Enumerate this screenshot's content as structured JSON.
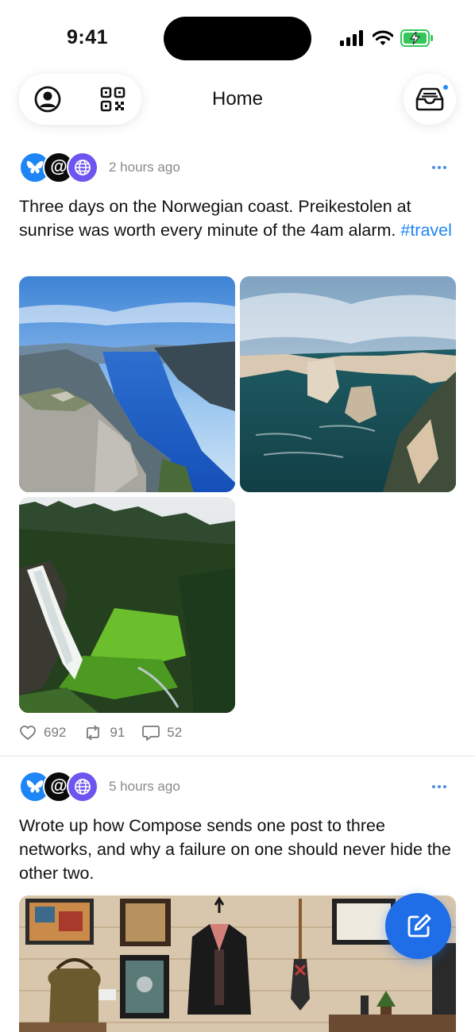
{
  "status_bar": {
    "time": "9:41"
  },
  "header": {
    "title": "Home",
    "profile_icon": "person-circle-icon",
    "qr_icon": "qr-code-icon",
    "inbox_icon": "inbox-tray-icon",
    "inbox_badge_color": "#1d8ff5"
  },
  "posts": [
    {
      "networks": [
        "bluesky",
        "at-protocol",
        "web"
      ],
      "at_glyph": "@",
      "time": "2 hours ago",
      "text": "Three days on the Norwegian coast. Preikestolen at sunrise was worth every minute of the 4am alarm. ",
      "hashtag": "#travel",
      "images": [
        "fjord-cliff",
        "sea-stacks-coast",
        "waterfall-forest"
      ],
      "likes": "692",
      "reposts": "91",
      "replies": "52"
    },
    {
      "networks": [
        "bluesky",
        "at-protocol",
        "web"
      ],
      "at_glyph": "@",
      "time": "5 hours ago",
      "text": "Wrote up how Compose sends one post to three networks, and why a failure on one should never hide the other two.",
      "images": [
        "shop-interior-wall"
      ]
    }
  ],
  "fab": {
    "icon": "compose-icon",
    "color": "#1f6ee8"
  },
  "colors": {
    "accent": "#1d85f5",
    "bluesky": "#1d85f5",
    "web": "#6d55f0"
  }
}
